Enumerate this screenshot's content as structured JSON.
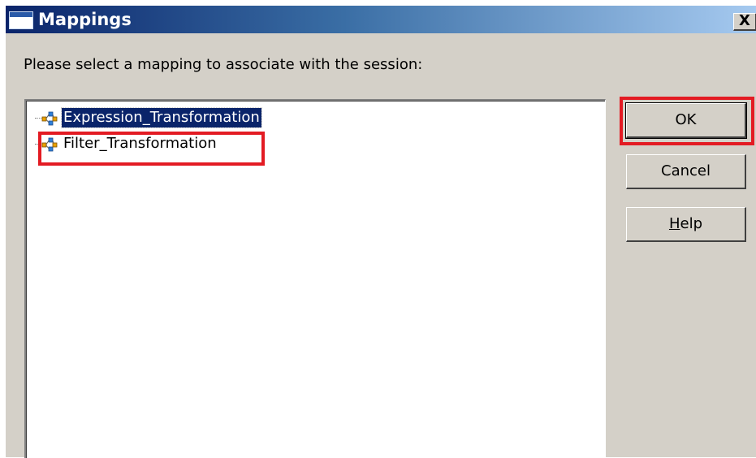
{
  "window": {
    "title": "Mappings",
    "title_icon": "window-icon",
    "close_label": "X"
  },
  "prompt": "Please select a mapping to associate with the session:",
  "mappings": [
    {
      "label": "Expression_Transformation",
      "icon": "mapping-icon",
      "selected": true
    },
    {
      "label": "Filter_Transformation",
      "icon": "mapping-icon",
      "selected": false
    }
  ],
  "buttons": {
    "ok": "OK",
    "cancel": "Cancel",
    "help_mnemonic": "H",
    "help_rest": "elp"
  },
  "colors": {
    "title_gradient_start": "#0a246a",
    "title_gradient_end": "#a6caf0",
    "selection": "#0a246a",
    "annotation_red": "#e31b23",
    "dialog_face": "#d4d0c8"
  }
}
